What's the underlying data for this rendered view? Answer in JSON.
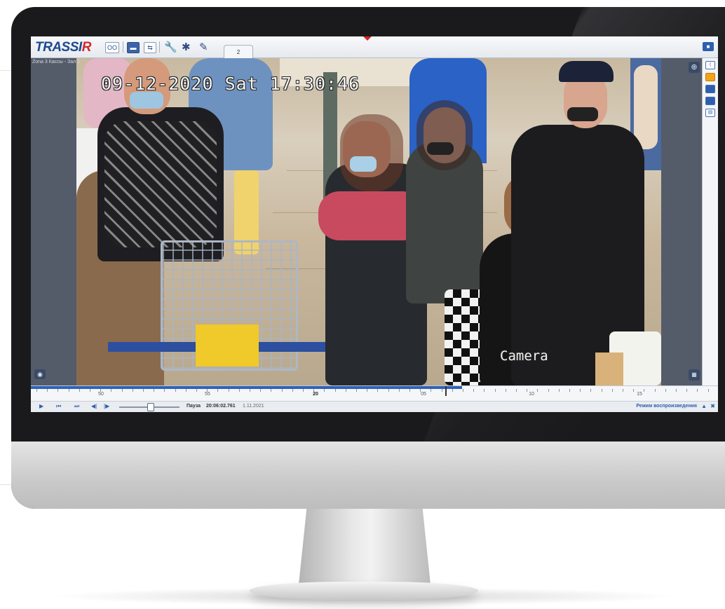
{
  "app": {
    "logo_part1": "TRASSI",
    "logo_part2": "R",
    "tab_label": "2",
    "camera_label": "Zona 3 Кассы - Зал 1"
  },
  "toolbar": {
    "buttons": [
      "screens",
      "messages",
      "layout",
      "settings",
      "plugins",
      "edit"
    ],
    "icons": {
      "btn1": "OO",
      "btn2": "▬",
      "btn3": "⇆",
      "btn4": "🔧",
      "btn5": "✱",
      "btn6": "✎",
      "cam": "■"
    }
  },
  "video": {
    "osd_date": "09-12-2020 Sat 17:30:46",
    "osd_camera": "Camera"
  },
  "timeline": {
    "ticks": [
      {
        "label": "50",
        "bold": false
      },
      {
        "label": "55",
        "bold": false
      },
      {
        "label": "20",
        "bold": true
      },
      {
        "label": "05",
        "bold": false
      },
      {
        "label": "10",
        "bold": false
      },
      {
        "label": "15",
        "bold": false
      }
    ],
    "progress": 0.628
  },
  "controls": {
    "play": "▶",
    "prev_frame_block": "⏮",
    "next_frame_block": "⏭",
    "step_back": "◀|",
    "step_fwd": "|▶",
    "state": "Пауза",
    "time": "20:06:02.761",
    "date": "1.11.2021",
    "mode": "Режим воспроизведения",
    "up_icon": "▲",
    "close_icon": "✖"
  },
  "colors": {
    "brand_blue": "#1d4a8c",
    "brand_red": "#d8262b",
    "accent": "#2e63b8"
  }
}
